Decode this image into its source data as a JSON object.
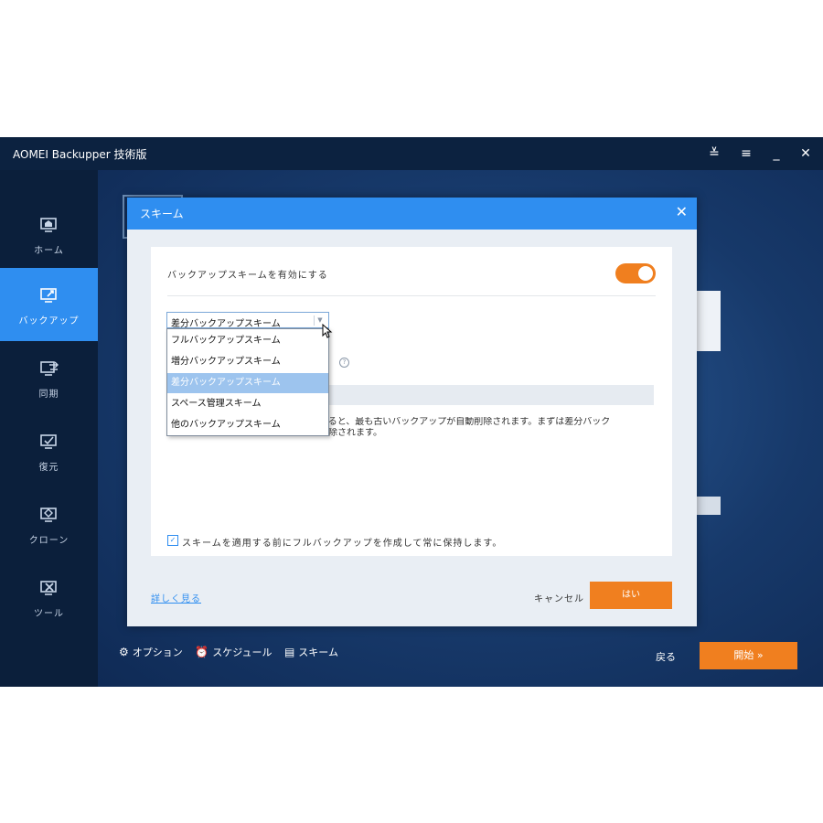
{
  "app": {
    "title": "AOMEI Backupper 技術版"
  },
  "titlebar": {
    "icons": [
      "upgrade-icon",
      "menu-icon",
      "minimize-icon",
      "close-icon"
    ]
  },
  "sidebar": {
    "items": [
      {
        "label": "ホーム",
        "icon": "home-icon",
        "active": false
      },
      {
        "label": "バックアップ",
        "icon": "backup-icon",
        "active": true
      },
      {
        "label": "同期",
        "icon": "sync-icon",
        "active": false
      },
      {
        "label": "復元",
        "icon": "restore-icon",
        "active": false
      },
      {
        "label": "クローン",
        "icon": "clone-icon",
        "active": false
      },
      {
        "label": "ツール",
        "icon": "tools-icon",
        "active": false
      }
    ]
  },
  "bottom": {
    "options": "オプション",
    "schedule": "スケジュール",
    "scheme": "スキーム",
    "back": "戻る",
    "start": "開始 »"
  },
  "dialog": {
    "title": "スキーム",
    "enable_label": "バックアップスキームを有効にする",
    "toggle_on": true,
    "selected": "差分バックアップスキーム",
    "options": [
      "フルバックアップスキーム",
      "増分バックアップスキーム",
      "差分バックアップスキーム",
      "スペース管理スキーム",
      "他のバックアップスキーム"
    ],
    "selected_index": 2,
    "description": [
      "超えると、最も古いバックアップが自動削除されます。まずは差分バック",
      "り削除されます。"
    ],
    "checkbox_label": "スキームを適用する前にフルバックアップを作成して常に保持します。",
    "checkbox_checked": true,
    "detail_link": "詳しく見る",
    "cancel": "キャンセル",
    "ok": "はい"
  },
  "colors": {
    "accent": "#2f8ef0",
    "orange": "#f07f1f",
    "sidebar": "#0b1f3b",
    "titlebar": "#0c2240"
  }
}
